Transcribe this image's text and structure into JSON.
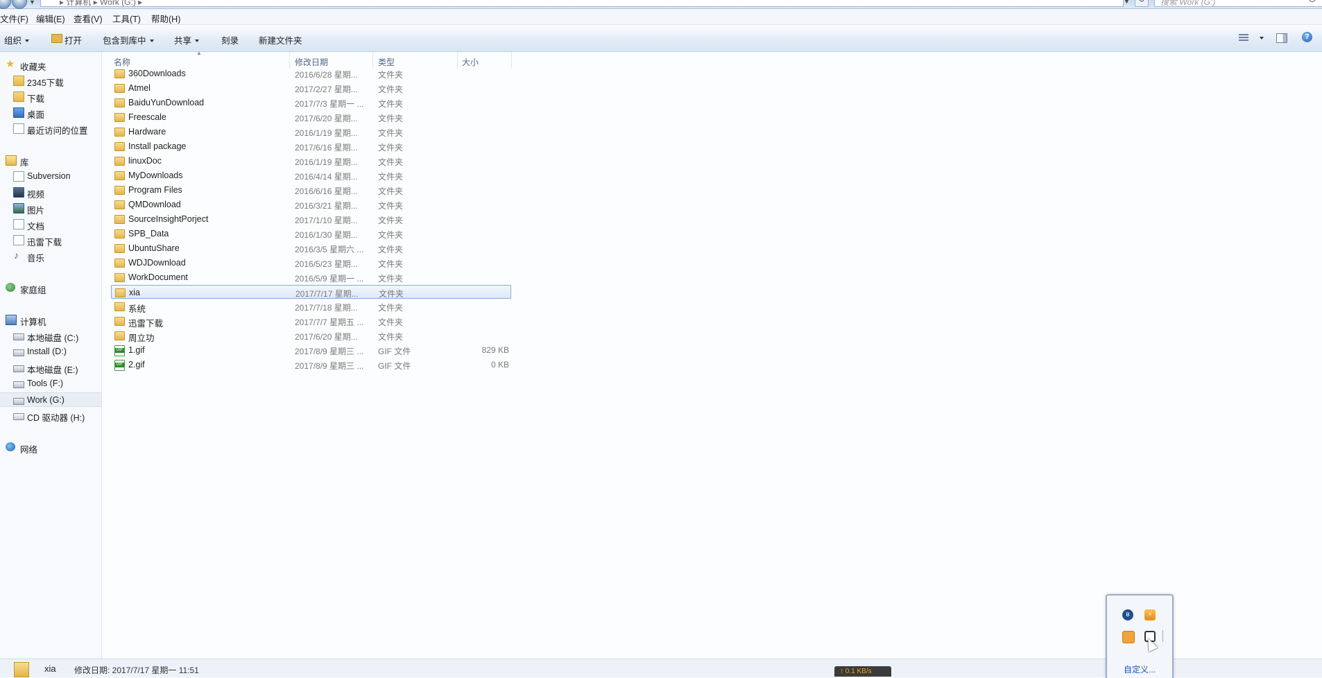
{
  "address_bar": {
    "path_text": "▸ 计算机 ▸ Work (G:) ▸",
    "search_placeholder": "搜索 Work (G:)",
    "refresh_glyph": "↻",
    "dropdown_glyph": "▼"
  },
  "menu": {
    "file": "文件(F)",
    "edit": "编辑(E)",
    "view": "查看(V)",
    "tools": "工具(T)",
    "help": "帮助(H)"
  },
  "toolbar": {
    "organize": "组织",
    "open": "打开",
    "include_in_library": "包含到库中",
    "share": "共享",
    "burn": "刻录",
    "new_folder": "新建文件夹",
    "help_glyph": "?"
  },
  "sidebar": {
    "favorites": {
      "label": "收藏夹",
      "items": [
        "2345下载",
        "下载",
        "桌面",
        "最近访问的位置"
      ]
    },
    "libraries": {
      "label": "库",
      "items": [
        "Subversion",
        "视频",
        "图片",
        "文档",
        "迅雷下载",
        "音乐"
      ]
    },
    "homegroup": "家庭组",
    "computer": {
      "label": "计算机",
      "items": [
        "本地磁盘 (C:)",
        "Install (D:)",
        "本地磁盘 (E:)",
        "Tools (F:)",
        "Work (G:)",
        "CD 驱动器 (H:)"
      ],
      "active_item": "Work (G:)"
    },
    "network": "网络"
  },
  "columns": {
    "name": "名称",
    "date": "修改日期",
    "type": "类型",
    "size": "大小"
  },
  "files": [
    {
      "name": "360Downloads",
      "date": "2016/6/28 星期...",
      "type": "文件夹",
      "size": "",
      "kind": "folder"
    },
    {
      "name": "Atmel",
      "date": "2017/2/27 星期...",
      "type": "文件夹",
      "size": "",
      "kind": "folder"
    },
    {
      "name": "BaiduYunDownload",
      "date": "2017/7/3 星期一 ...",
      "type": "文件夹",
      "size": "",
      "kind": "folder"
    },
    {
      "name": "Freescale",
      "date": "2017/6/20 星期...",
      "type": "文件夹",
      "size": "",
      "kind": "folder"
    },
    {
      "name": "Hardware",
      "date": "2016/1/19 星期...",
      "type": "文件夹",
      "size": "",
      "kind": "folder"
    },
    {
      "name": "Install package",
      "date": "2017/6/16 星期...",
      "type": "文件夹",
      "size": "",
      "kind": "folder"
    },
    {
      "name": "linuxDoc",
      "date": "2016/1/19 星期...",
      "type": "文件夹",
      "size": "",
      "kind": "folder"
    },
    {
      "name": "MyDownloads",
      "date": "2016/4/14 星期...",
      "type": "文件夹",
      "size": "",
      "kind": "folder"
    },
    {
      "name": "Program Files",
      "date": "2016/6/16 星期...",
      "type": "文件夹",
      "size": "",
      "kind": "folder"
    },
    {
      "name": "QMDownload",
      "date": "2016/3/21 星期...",
      "type": "文件夹",
      "size": "",
      "kind": "folder"
    },
    {
      "name": "SourceInsightPorject",
      "date": "2017/1/10 星期...",
      "type": "文件夹",
      "size": "",
      "kind": "folder"
    },
    {
      "name": "SPB_Data",
      "date": "2016/1/30 星期...",
      "type": "文件夹",
      "size": "",
      "kind": "folder"
    },
    {
      "name": "UbuntuShare",
      "date": "2016/3/5 星期六 ...",
      "type": "文件夹",
      "size": "",
      "kind": "folder"
    },
    {
      "name": "WDJDownload",
      "date": "2016/5/23 星期...",
      "type": "文件夹",
      "size": "",
      "kind": "folder"
    },
    {
      "name": "WorkDocument",
      "date": "2016/5/9 星期一 ...",
      "type": "文件夹",
      "size": "",
      "kind": "folder"
    },
    {
      "name": "xia",
      "date": "2017/7/17 星期...",
      "type": "文件夹",
      "size": "",
      "kind": "folder",
      "selected": true
    },
    {
      "name": "系统",
      "date": "2017/7/18 星期...",
      "type": "文件夹",
      "size": "",
      "kind": "folder"
    },
    {
      "name": "迅雷下载",
      "date": "2017/7/7 星期五 ...",
      "type": "文件夹",
      "size": "",
      "kind": "folder"
    },
    {
      "name": "周立功",
      "date": "2017/6/20 星期...",
      "type": "文件夹",
      "size": "",
      "kind": "folder"
    },
    {
      "name": "1.gif",
      "date": "2017/8/9 星期三 ...",
      "type": "GIF 文件",
      "size": "829 KB",
      "kind": "gif"
    },
    {
      "name": "2.gif",
      "date": "2017/8/9 星期三 ...",
      "type": "GIF 文件",
      "size": "0 KB",
      "kind": "gif"
    }
  ],
  "status": {
    "name": "xia",
    "detail": "修改日期: 2017/7/17 星期一 11:51"
  },
  "tray": {
    "customize": "自定义...",
    "bluetooth_glyph": "ʙ",
    "shield_glyph": "⚡"
  },
  "netspeed": "↑ 0.1 KB/s"
}
